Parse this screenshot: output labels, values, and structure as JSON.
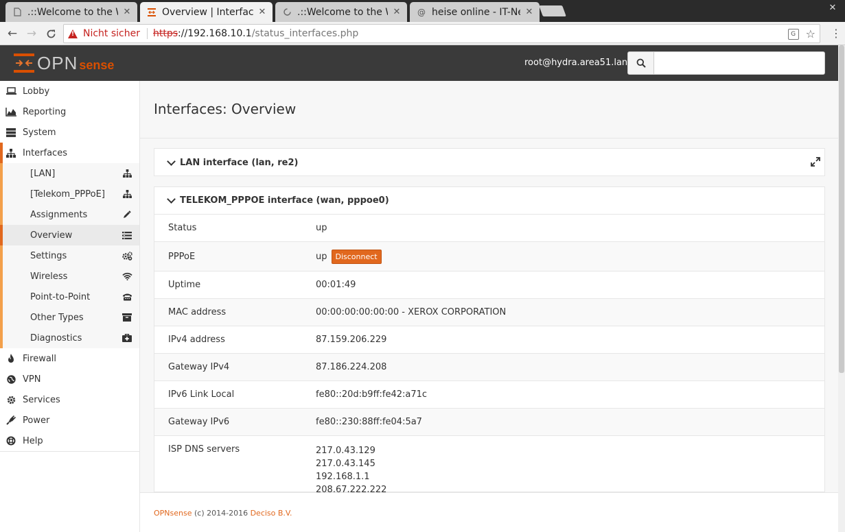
{
  "browser": {
    "tabs": [
      {
        "title": ".::Welcome to the W",
        "active": false
      },
      {
        "title": "Overview | Interfac",
        "active": true
      },
      {
        "title": ".::Welcome to the W",
        "active": false
      },
      {
        "title": "heise online - IT-Ne",
        "active": false
      }
    ],
    "tab_close": "✕",
    "security_label": "Nicht sicher",
    "url_scheme": "https",
    "url_host": "://192.168.10.1",
    "url_path": "/status_interfaces.php"
  },
  "header": {
    "logo_opn": "OPN",
    "logo_sense": "sense",
    "user": "root@hydra.area51.lan",
    "search_value": ""
  },
  "sidebar": {
    "lobby": "Lobby",
    "reporting": "Reporting",
    "system": "System",
    "interfaces": "Interfaces",
    "sub": [
      {
        "label": "[LAN]"
      },
      {
        "label": "[Telekom_PPPoE]"
      },
      {
        "label": "Assignments"
      },
      {
        "label": "Overview"
      },
      {
        "label": "Settings"
      },
      {
        "label": "Wireless"
      },
      {
        "label": "Point-to-Point"
      },
      {
        "label": "Other Types"
      },
      {
        "label": "Diagnostics"
      }
    ],
    "firewall": "Firewall",
    "vpn": "VPN",
    "services": "Services",
    "power": "Power",
    "help": "Help"
  },
  "main": {
    "title": "Interfaces: Overview",
    "lan_panel": "LAN interface (lan, re2)",
    "wan_panel": "TELEKOM_PPPOE interface (wan, pppoe0)",
    "rows": [
      {
        "key": "Status",
        "value": "up"
      },
      {
        "key": "PPPoE",
        "value": "up",
        "button": "Disconnect"
      },
      {
        "key": "Uptime",
        "value": "00:01:49"
      },
      {
        "key": "MAC address",
        "value": "00:00:00:00:00:00 - XEROX CORPORATION"
      },
      {
        "key": "IPv4 address",
        "value": "87.159.206.229"
      },
      {
        "key": "Gateway IPv4",
        "value": "87.186.224.208"
      },
      {
        "key": "IPv6 Link Local",
        "value": "fe80::20d:b9ff:fe42:a71c"
      },
      {
        "key": "Gateway IPv6",
        "value": "fe80::230:88ff:fe04:5a7"
      },
      {
        "key": "ISP DNS servers",
        "values": [
          "217.0.43.129",
          "217.0.43.145",
          "192.168.1.1",
          "208.67.222.222"
        ]
      }
    ]
  },
  "footer": {
    "brand": "OPNsense",
    "text": " (c) 2014-2016 ",
    "company": "Deciso B.V."
  },
  "colors": {
    "accent": "#e1681e",
    "header_bg": "#3a3a3a",
    "insecure": "#c5221f"
  }
}
